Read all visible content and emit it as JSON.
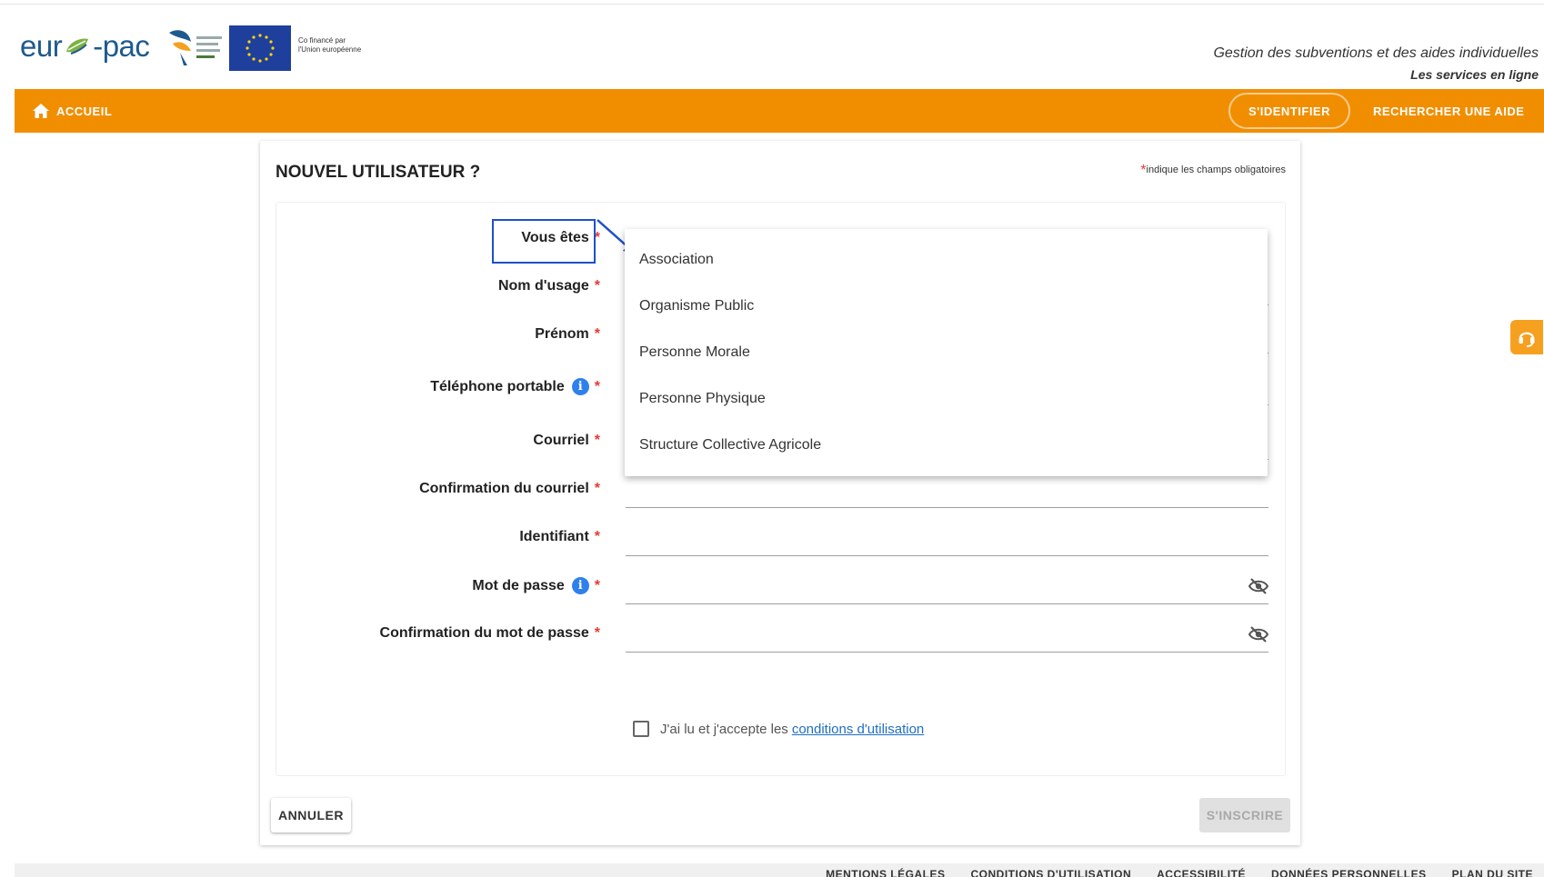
{
  "header": {
    "logo_left": "eur",
    "logo_right": "-pac",
    "cofinance_line1": "Co financé par",
    "cofinance_line2": "l'Union européenne",
    "tagline": "Gestion des subventions et des aides individuelles",
    "subtagline": "Les services en ligne"
  },
  "nav": {
    "home_label": "ACCUEIL",
    "login_label": "S'IDENTIFIER",
    "search_label": "RECHERCHER UNE AIDE"
  },
  "form": {
    "title": "NOUVEL UTILISATEUR ?",
    "required_note": "indique les champs obligatoires",
    "required_mark": "*",
    "info_glyph": "i",
    "fields": {
      "user_type": {
        "label": "Vous êtes",
        "value": ""
      },
      "last_name": {
        "label": "Nom d'usage",
        "value": ""
      },
      "first_name": {
        "label": "Prénom",
        "value": ""
      },
      "mobile_phone": {
        "label": "Téléphone portable",
        "value": ""
      },
      "email": {
        "label": "Courriel",
        "value": ""
      },
      "email_confirm": {
        "label": "Confirmation du courriel",
        "value": ""
      },
      "username": {
        "label": "Identifiant",
        "value": ""
      },
      "password": {
        "label": "Mot de passe",
        "value": ""
      },
      "password_confirm": {
        "label": "Confirmation du mot de passe",
        "value": ""
      }
    },
    "terms_text": "J'ai lu et j'accepte les",
    "terms_link": "conditions d'utilisation",
    "cancel_label": "ANNULER",
    "register_label": "S'INSCRIRE"
  },
  "dropdown": {
    "options": [
      "Association",
      "Organisme Public",
      "Personne Morale",
      "Personne Physique",
      "Structure Collective Agricole"
    ]
  },
  "footer": {
    "links": [
      "MENTIONS LÉGALES",
      "CONDITIONS D'UTILISATION",
      "ACCESSIBILITÉ",
      "DONNÉES PERSONNELLES",
      "PLAN DU SITE"
    ]
  },
  "colors": {
    "brand_orange": "#f18e00",
    "highlight_blue": "#1e50c8",
    "required_red": "#e53935",
    "info_blue": "#2f80ed"
  }
}
